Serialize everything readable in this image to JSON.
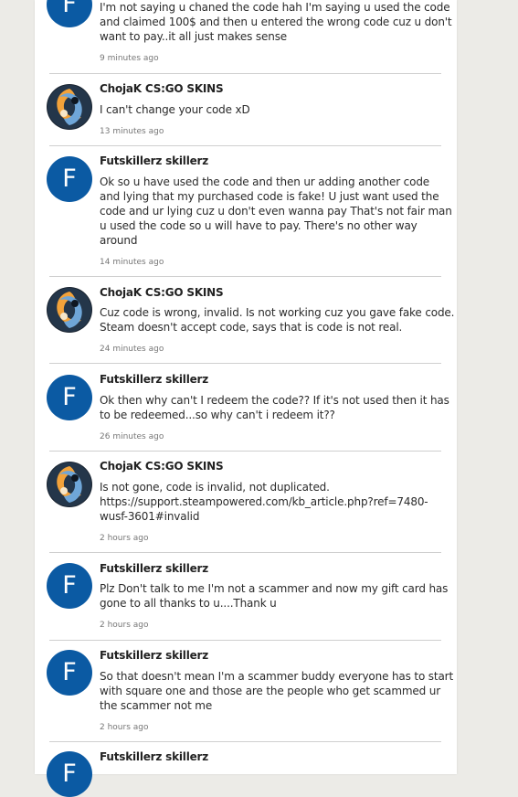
{
  "comments": [
    {
      "author": "",
      "avatar": "F",
      "avatar_type": "letter",
      "text_lines": [
        "I'm not saying u chaned the code hah I'm saying u used the code",
        "and claimed 100$ and then u entered the wrong code cuz u don't",
        "want to pay..it all just makes sense"
      ],
      "time": "9 minutes ago"
    },
    {
      "author": "ChojaK CS:GO SKINS",
      "avatar": "",
      "avatar_type": "image",
      "text_lines": [
        "I can't change your code xD"
      ],
      "time": "13 minutes ago"
    },
    {
      "author": "Futskillerz skillerz",
      "avatar": "F",
      "avatar_type": "letter",
      "text_lines": [
        "Ok so u have used the code and then ur adding another code",
        "and lying that my purchased code is fake! U just want used the",
        "code and ur lying cuz u don't even wanna pay That's not fair man",
        "u used the code so u will have to pay. There's no other way",
        "around"
      ],
      "time": "14 minutes ago"
    },
    {
      "author": "ChojaK CS:GO SKINS",
      "avatar": "",
      "avatar_type": "image",
      "text_lines": [
        "Cuz code is wrong, invalid. Is not working cuz you gave fake code.",
        "Steam doesn't accept code, says that is code is not real."
      ],
      "time": "24 minutes ago"
    },
    {
      "author": "Futskillerz skillerz",
      "avatar": "F",
      "avatar_type": "letter",
      "text_lines": [
        "Ok then why can't I redeem the code?? If it's not used then it has",
        "to be redeemed...so why can't i redeem it??"
      ],
      "time": "26 minutes ago"
    },
    {
      "author": "ChojaK CS:GO SKINS",
      "avatar": "",
      "avatar_type": "image",
      "text_lines": [
        "Is not gone, code is invalid, not duplicated.",
        "https://support.steampowered.com/kb_article.php?ref=7480-",
        "wusf-3601#invalid"
      ],
      "time": "2 hours ago"
    },
    {
      "author": "Futskillerz skillerz",
      "avatar": "F",
      "avatar_type": "letter",
      "text_lines": [
        "Plz Don't talk to me I'm not a scammer and now my gift card has",
        "gone to all thanks to u....Thank u"
      ],
      "time": "2 hours ago"
    },
    {
      "author": "Futskillerz skillerz",
      "avatar": "F",
      "avatar_type": "letter",
      "text_lines": [
        "So that doesn't mean I'm a scammer buddy everyone has to start",
        "with square one and those are the people who get scammed ur",
        "the scammer not me"
      ],
      "time": "2 hours ago"
    },
    {
      "author": "Futskillerz skillerz",
      "avatar": "F",
      "avatar_type": "letter",
      "text_lines": [],
      "time": ""
    }
  ],
  "colors": {
    "background": "#ecebe7",
    "panel": "#ffffff",
    "avatar_blue": "#0b5aa3",
    "divider": "#cfcfcf"
  }
}
